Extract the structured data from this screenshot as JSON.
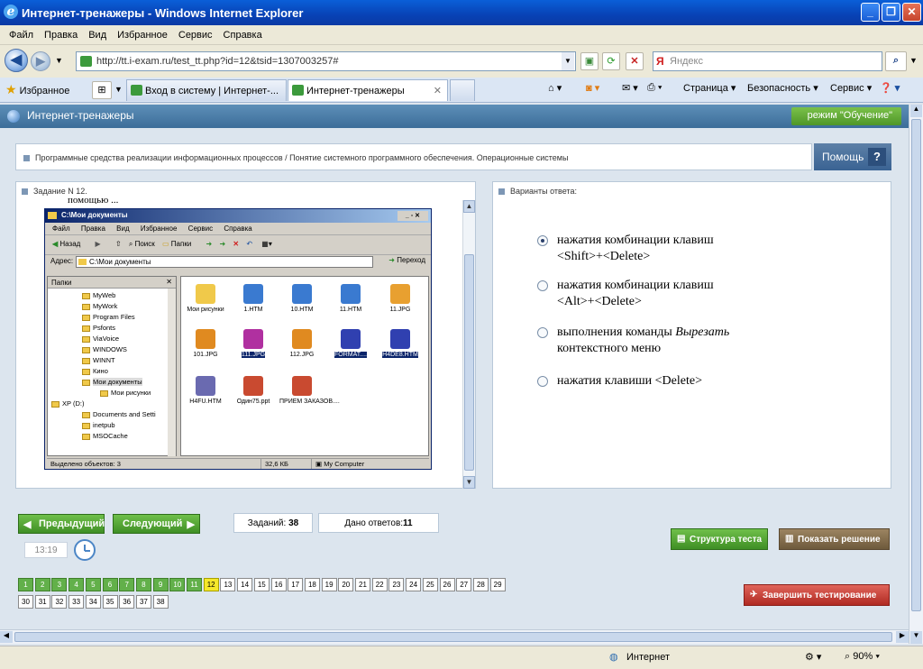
{
  "window": {
    "title": "Интернет-тренажеры - Windows Internet Explorer"
  },
  "menu": [
    "Файл",
    "Правка",
    "Вид",
    "Избранное",
    "Сервис",
    "Справка"
  ],
  "address": {
    "url": "http://tt.i-exam.ru/test_tt.php?id=12&tsid=1307003257#",
    "search_placeholder": "Яндекс"
  },
  "favorites_label": "Избранное",
  "tabs": [
    {
      "label": "Вход в систему | Интернет-..."
    },
    {
      "label": "Интернет-тренажеры"
    }
  ],
  "commands": {
    "page": "Страница",
    "security": "Безопасность",
    "service": "Сервис"
  },
  "page": {
    "title": "Интернет-тренажеры",
    "mode": "режим \"Обучение\"",
    "breadcrumb": "Программные средства реализации информационных процессов / Понятие системного программного обеспечения. Операционные системы",
    "help": "Помощь",
    "help_q": "?",
    "task_label": "Задание N 12.",
    "task_text_fragment": "помощью ...",
    "answers_label": "Варианты ответа:"
  },
  "explorer": {
    "title": "C:\\Мои документы",
    "menu": [
      "Файл",
      "Правка",
      "Вид",
      "Избранное",
      "Сервис",
      "Справка"
    ],
    "toolbar": {
      "back": "Назад",
      "search": "Поиск",
      "folders": "Папки"
    },
    "address_label": "Адрес:",
    "address_value": "C:\\Мои документы",
    "go": "Переход",
    "folders_header": "Папки",
    "folders": [
      "MyWeb",
      "MyWork",
      "Program Files",
      "Psfonts",
      "ViaVoice",
      "WINDOWS",
      "WINNT",
      "Кино",
      "Мои документы",
      "Мои рисунки",
      "XP (D:)",
      "Documents and Setti",
      "inetpub",
      "MSOCache"
    ],
    "files": [
      "Мои рисунки",
      "1.HTM",
      "10.HTM",
      "11.HTM",
      "11.JPG",
      "101.JPG",
      "111.JPG",
      "112.JPG",
      "FORMAT....",
      "H4DE8.HTM",
      "H4FU.HTM",
      "Один75.ppt",
      "ПРИЕМ ЗАКАЗОВ...."
    ],
    "status": {
      "selected": "Выделено объектов: 3",
      "size": "32,6 КБ",
      "location": "My Computer"
    }
  },
  "answers": [
    {
      "line1": "нажатия комбинации клавиш",
      "line2": "<Shift>+<Delete>",
      "selected": true
    },
    {
      "line1": "нажатия комбинации клавиш",
      "line2": "<Alt>+<Delete>",
      "selected": false
    },
    {
      "line1": "выполнения команды ",
      "line1_italic": "Вырезать",
      "line2": "контекстного меню",
      "selected": false
    },
    {
      "line1": "нажатия клавиши <Delete>",
      "line2": "",
      "selected": false
    }
  ],
  "nav": {
    "prev": "Предыдущий",
    "next": "Следующий",
    "tasks_label": "Заданий:",
    "tasks_count": "38",
    "answered_label": "Дано ответов:",
    "answered_count": "11",
    "timer": "13:19",
    "structure": "Структура теста",
    "show_solution": "Показать решение",
    "finish": "Завершить тестирование"
  },
  "questions": {
    "total": 38,
    "done_until": 11,
    "current": 12
  },
  "statusbar": {
    "zone": "Интернет",
    "zoom": "90%"
  },
  "colors": {
    "accent": "#3c6d99",
    "green": "#4e9628",
    "current": "#f5e82a",
    "finish": "#c8342a"
  }
}
